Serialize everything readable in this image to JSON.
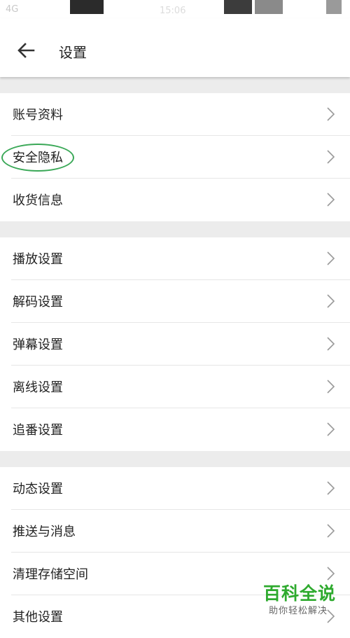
{
  "status_bar": {
    "left": "4G",
    "time": "15:06"
  },
  "header": {
    "back_icon": "arrow-left-icon",
    "title": "设置"
  },
  "groups": [
    {
      "items": [
        {
          "label": "账号资料"
        },
        {
          "label": "安全隐私"
        },
        {
          "label": "收货信息"
        }
      ]
    },
    {
      "items": [
        {
          "label": "播放设置"
        },
        {
          "label": "解码设置"
        },
        {
          "label": "弹幕设置"
        },
        {
          "label": "离线设置"
        },
        {
          "label": "追番设置"
        }
      ]
    },
    {
      "items": [
        {
          "label": "动态设置"
        },
        {
          "label": "推送与消息"
        },
        {
          "label": "清理存储空间"
        },
        {
          "label": "其他设置"
        }
      ]
    }
  ],
  "row_icon": "chevron-right-icon",
  "annotation": {
    "highlight_color": "#3aa857"
  },
  "watermark": {
    "title": "百科全说",
    "subtitle": "助你轻松解决"
  }
}
